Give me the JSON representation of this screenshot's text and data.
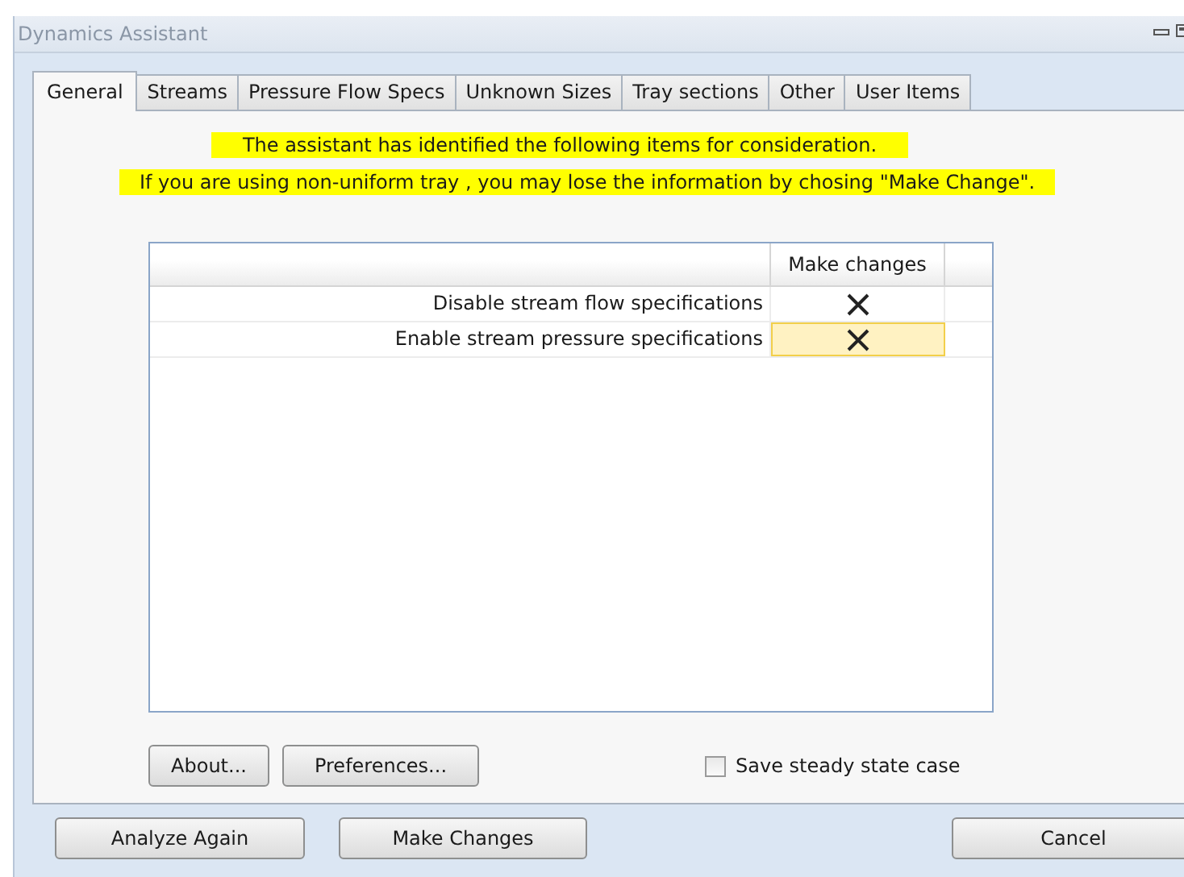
{
  "window": {
    "title": "Dynamics Assistant"
  },
  "tabs": [
    {
      "label": "General",
      "selected": true
    },
    {
      "label": "Streams",
      "selected": false
    },
    {
      "label": "Pressure Flow Specs",
      "selected": false
    },
    {
      "label": "Unknown Sizes",
      "selected": false
    },
    {
      "label": "Tray sections",
      "selected": false
    },
    {
      "label": "Other",
      "selected": false
    },
    {
      "label": "User Items",
      "selected": false
    }
  ],
  "notices": [
    "The assistant has identified the following items for consideration.",
    "If you are using non-uniform tray , you may lose the information by chosing \"Make Change\"."
  ],
  "table": {
    "columns": [
      "Make changes"
    ],
    "rows": [
      {
        "item": "Disable stream flow specifications",
        "checked": true,
        "selected": false
      },
      {
        "item": "Enable stream pressure specifications",
        "checked": true,
        "selected": true
      }
    ]
  },
  "panel_buttons": [
    "About...",
    "Preferences..."
  ],
  "save_steady_state": {
    "label": "Save steady state case",
    "checked": false
  },
  "buttons": [
    "Analyze Again",
    "Make Changes",
    "Cancel"
  ]
}
